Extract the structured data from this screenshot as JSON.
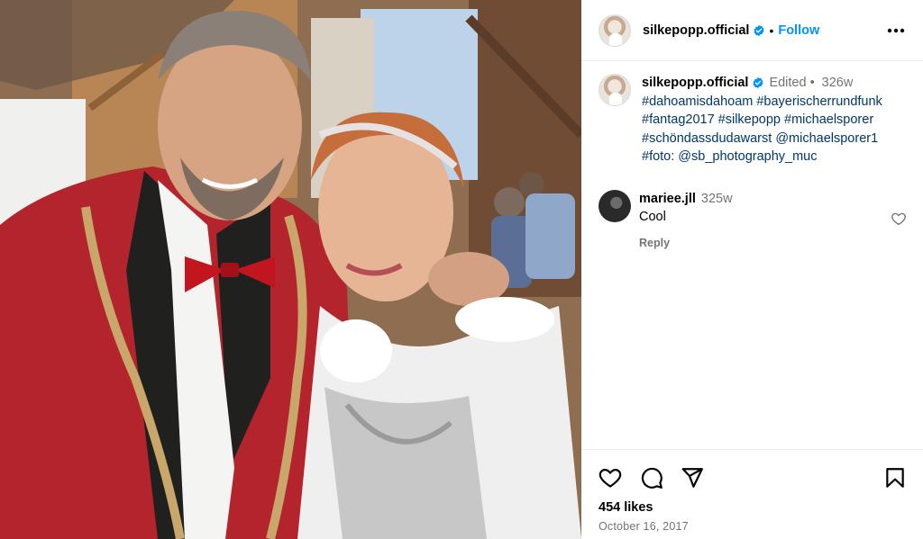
{
  "post": {
    "username": "silkepopp.official",
    "follow_label": "Follow",
    "dot": "•"
  },
  "caption": {
    "username": "silkepopp.official",
    "edited": "Edited",
    "separator": "•",
    "age": "326w",
    "lines": [
      "#dahoamisdahoam #bayerischerrundfunk",
      "#fantag2017 #silkepopp #michaelsporer",
      "#schöndassdudawarst @michaelsporer1",
      "#foto: @sb_photography_muc"
    ]
  },
  "comment": {
    "username": "mariee.jll",
    "age": "325w",
    "text": "Cool",
    "reply_label": "Reply"
  },
  "footer": {
    "likes": "454 likes",
    "date": "October 16, 2017"
  },
  "icons": {
    "verified": "verified-badge-icon",
    "more": "more-options-icon",
    "like": "heart-icon",
    "comment": "comment-bubble-icon",
    "share": "paper-plane-icon",
    "save": "bookmark-icon"
  },
  "colors": {
    "accent": "#0095f6",
    "hashtag": "#00376b",
    "muted": "#737373",
    "verified": "#0095f6"
  }
}
